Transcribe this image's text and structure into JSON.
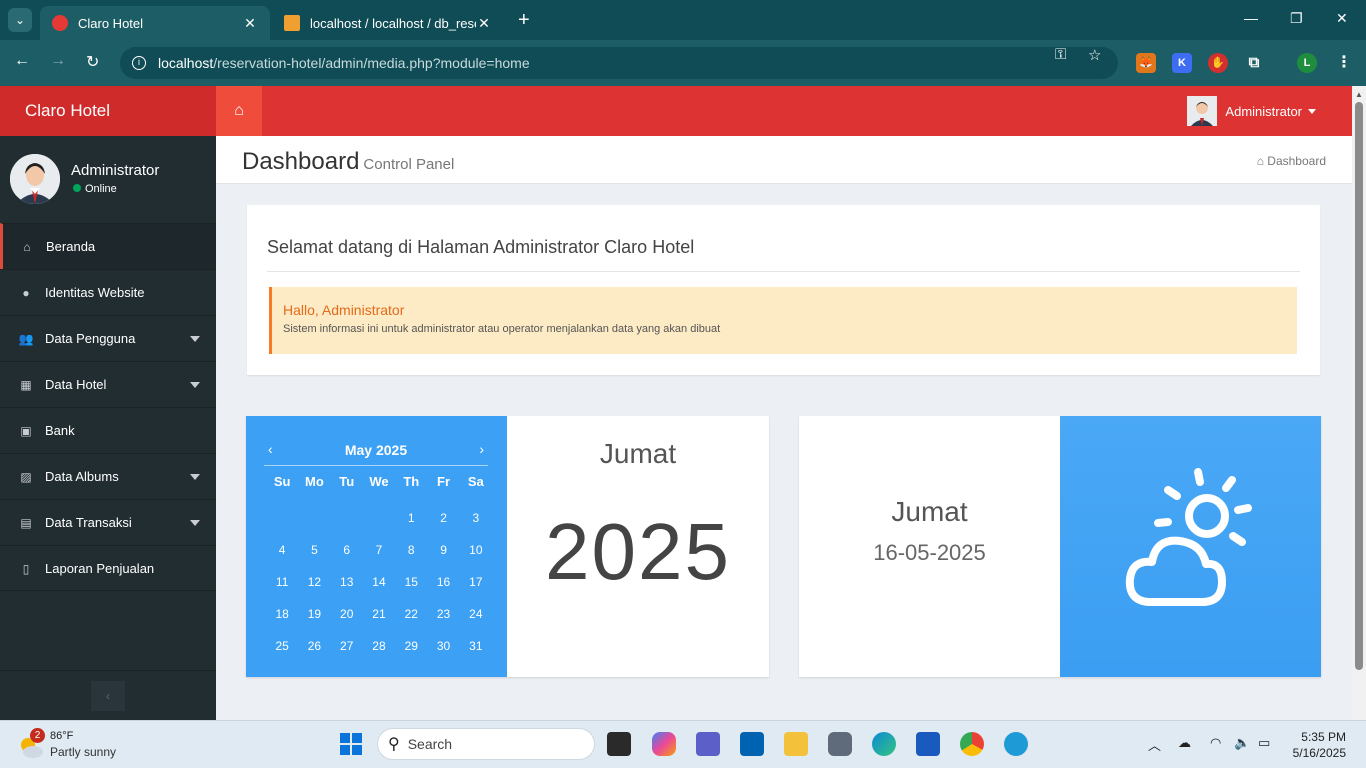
{
  "browser": {
    "tabs": [
      {
        "title": "Claro Hotel",
        "active": true
      },
      {
        "title": "localhost / localhost / db_reserv",
        "active": false
      }
    ],
    "url_host": "localhost",
    "url_path": "/reservation-hotel/admin/media.php?module=home",
    "profile_initial": "L"
  },
  "app": {
    "logo": "Claro Hotel",
    "topbar_user": "Administrator",
    "sidebar": {
      "user_name": "Administrator",
      "user_status": "Online",
      "items": [
        {
          "label": "Beranda",
          "icon": "home-icon",
          "has_submenu": false,
          "active": true
        },
        {
          "label": "Identitas Website",
          "icon": "globe-icon",
          "has_submenu": false,
          "active": false
        },
        {
          "label": "Data Pengguna",
          "icon": "users-icon",
          "has_submenu": true,
          "active": false
        },
        {
          "label": "Data Hotel",
          "icon": "building-icon",
          "has_submenu": true,
          "active": false
        },
        {
          "label": "Bank",
          "icon": "money-icon",
          "has_submenu": false,
          "active": false
        },
        {
          "label": "Data Albums",
          "icon": "image-icon",
          "has_submenu": true,
          "active": false
        },
        {
          "label": "Data Transaksi",
          "icon": "file-icon",
          "has_submenu": true,
          "active": false
        },
        {
          "label": "Laporan Penjualan",
          "icon": "file-outline-icon",
          "has_submenu": false,
          "active": false
        }
      ]
    },
    "header": {
      "title": "Dashboard",
      "subtitle": "Control Panel",
      "breadcrumb": "Dashboard"
    },
    "welcome": {
      "title": "Selamat datang di Halaman Administrator Claro Hotel",
      "callout_title": "Hallo, Administrator",
      "callout_text": "Sistem informasi ini untuk administrator atau operator menjalankan data yang akan dibuat"
    },
    "calendar": {
      "month": "May 2025",
      "prev": "‹",
      "next": "›",
      "weekdays": [
        "Su",
        "Mo",
        "Tu",
        "We",
        "Th",
        "Fr",
        "Sa"
      ],
      "weeks": [
        [
          "",
          "",
          "",
          "",
          "1",
          "2",
          "3"
        ],
        [
          "4",
          "5",
          "6",
          "7",
          "8",
          "9",
          "10"
        ],
        [
          "11",
          "12",
          "13",
          "14",
          "15",
          "16",
          "17"
        ],
        [
          "18",
          "19",
          "20",
          "21",
          "22",
          "23",
          "24"
        ],
        [
          "25",
          "26",
          "27",
          "28",
          "29",
          "30",
          "31"
        ]
      ]
    },
    "year_widget": {
      "day": "Jumat",
      "year": "2025"
    },
    "date_widget": {
      "day": "Jumat",
      "date": "16-05-2025"
    },
    "colors": {
      "header": "#dd3333",
      "logo_bg": "#cf2b2b",
      "sidebar": "#222d32",
      "calendar_bg": "#3ca0f4",
      "callout_bg": "#fdebc6"
    }
  },
  "taskbar": {
    "weather_temp": "86°F",
    "weather_desc": "Partly sunny",
    "weather_badge": "2",
    "search_label": "Search",
    "time": "5:35 PM",
    "date": "5/16/2025"
  }
}
